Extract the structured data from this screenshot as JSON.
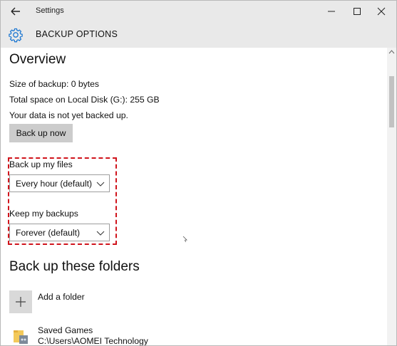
{
  "window": {
    "title": "Settings",
    "controls": [
      "minimize-icon",
      "maximize-icon",
      "close-icon"
    ]
  },
  "header": {
    "title": "BACKUP OPTIONS",
    "icon": "gear-icon"
  },
  "overview": {
    "heading": "Overview",
    "size_of_backup": "Size of backup: 0 bytes",
    "total_space": "Total space on Local Disk (G:): 255 GB",
    "status": "Your data is not yet backed up.",
    "backup_now_label": "Back up now"
  },
  "backup_frequency": {
    "label": "Back up my files",
    "selected": "Every hour (default)"
  },
  "keep_backups": {
    "label": "Keep my backups",
    "selected": "Forever (default)"
  },
  "folders": {
    "heading": "Back up these folders",
    "add_label": "Add a folder",
    "items": [
      {
        "name": "Saved Games",
        "path": "C:\\Users\\AOMEI Technology"
      }
    ]
  },
  "colors": {
    "titlebar_bg": "#e9e9e9",
    "highlight_border": "#d0141c",
    "accent_icon": "#1e78d2",
    "button_bg": "#cccccc"
  }
}
